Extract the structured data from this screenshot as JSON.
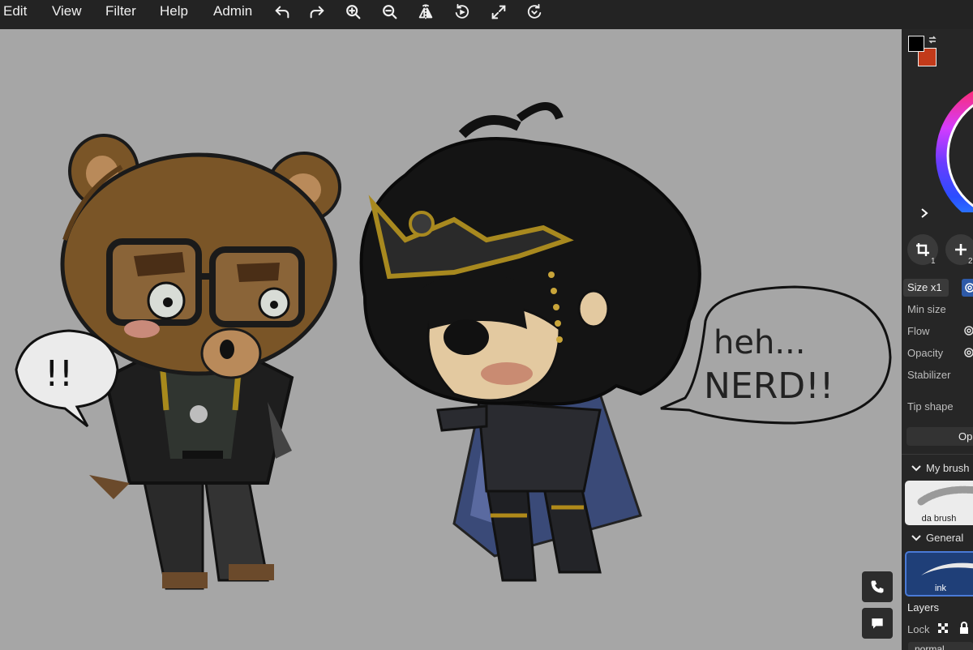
{
  "menu": {
    "items": [
      "Edit",
      "View",
      "Filter",
      "Help",
      "Admin"
    ]
  },
  "toolbar": {
    "icons": [
      "undo-icon",
      "redo-icon",
      "zoom-in-icon",
      "zoom-out-icon",
      "flip-icon",
      "rotate-icon",
      "fullscreen-icon",
      "reset-rotate-icon"
    ]
  },
  "canvas": {
    "background": "#a6a6a6",
    "speech_left": "!!",
    "speech_right_line1": "heh...",
    "speech_right_line2": "NERD!!",
    "call_button_icon": "phone-icon",
    "chat_button_icon": "chat-icon"
  },
  "panel": {
    "primary_color": "#000000",
    "secondary_color": "#c23a1a",
    "crop_badge": "1",
    "add_badge": "2",
    "size_label": "Size x1",
    "min_size_label": "Min size",
    "flow_label": "Flow",
    "opacity_label": "Opacity",
    "stabilizer_label": "Stabilizer",
    "tip_shape_label": "Tip shape",
    "options_button": "Op",
    "my_brushes_label": "My brush",
    "my_brush_name": "da brush",
    "general_label": "General",
    "general_brush_name": "ink",
    "layers_label": "Layers",
    "lock_label": "Lock",
    "blend_mode": "normal"
  }
}
